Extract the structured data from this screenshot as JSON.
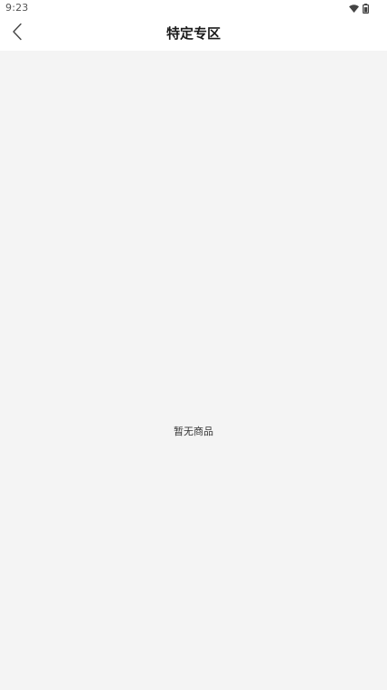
{
  "status_bar": {
    "time": "9:23",
    "icons": [
      "wifi-icon",
      "battery-icon"
    ]
  },
  "header": {
    "title": "特定专区",
    "back_icon": "chevron-left-icon"
  },
  "content": {
    "empty_message": "暂无商品"
  },
  "colors": {
    "background": "#f4f4f4",
    "header_background": "#ffffff",
    "title_text": "#1a1a1a",
    "body_text": "#333333"
  }
}
